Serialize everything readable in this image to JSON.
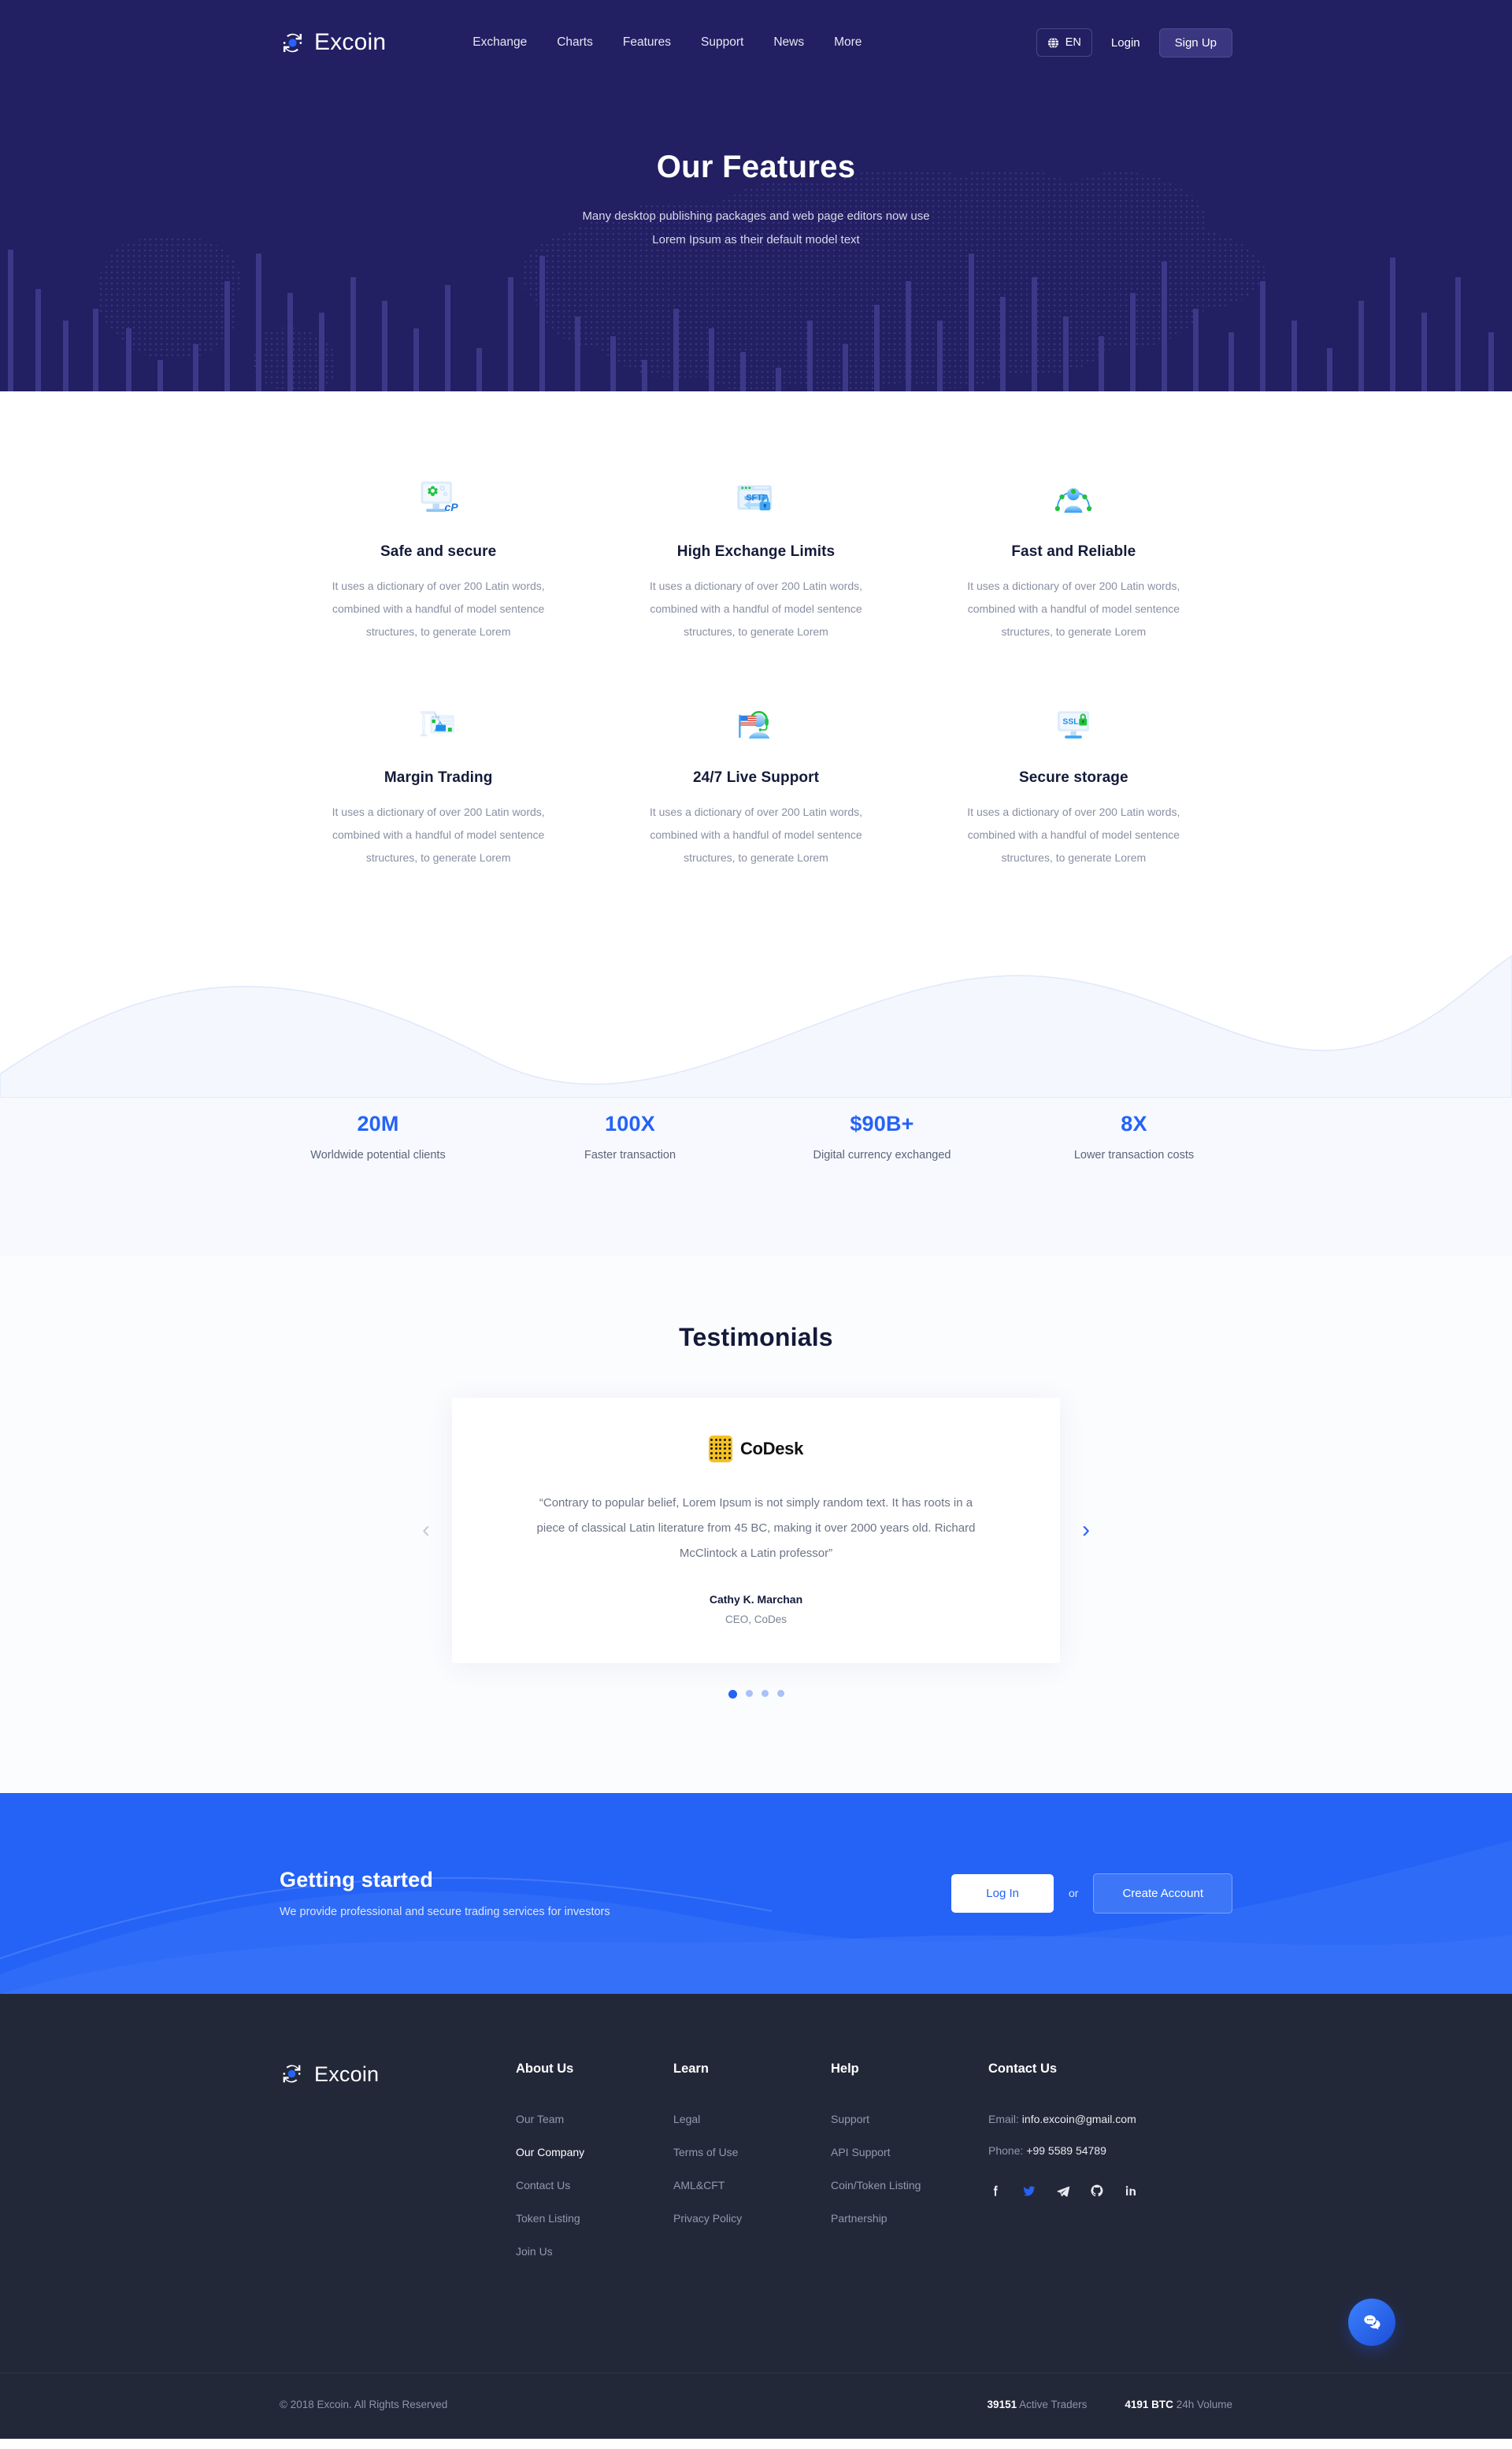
{
  "brand": {
    "name": "Excoin",
    "logo_icon": "refresh-circle-logo-icon"
  },
  "header": {
    "nav": [
      {
        "label": "Exchange"
      },
      {
        "label": "Charts"
      },
      {
        "label": "Features"
      },
      {
        "label": "Support"
      },
      {
        "label": "News"
      },
      {
        "label": "More"
      }
    ],
    "language": {
      "label": "EN",
      "icon": "globe-icon"
    },
    "login_label": "Login",
    "signup_label": "Sign Up"
  },
  "hero": {
    "title": "Our Features",
    "subtitle_line1": "Many desktop publishing packages and web page editors now use",
    "subtitle_line2": "Lorem Ipsum as their default model text",
    "background_color": "#221f62"
  },
  "features": [
    {
      "icon": "cpanel-monitor-icon",
      "title": "Safe and secure",
      "body": "It uses a dictionary of over 200 Latin words, combined with a handful of model sentence structures, to generate Lorem"
    },
    {
      "icon": "sftp-browser-lock-icon",
      "title": "High Exchange Limits",
      "body": "It uses a dictionary of over 200 Latin words, combined with a handful of model sentence structures, to generate Lorem"
    },
    {
      "icon": "network-user-nodes-icon",
      "title": "Fast and Reliable",
      "body": "It uses a dictionary of over 200 Latin words, combined with a handful of model sentence structures, to generate Lorem"
    },
    {
      "icon": "crane-website-builder-icon",
      "title": "Margin Trading",
      "body": "It uses a dictionary of over 200 Latin words, combined with a handful of model sentence structures, to generate Lorem"
    },
    {
      "icon": "support-headset-flag-icon",
      "title": "24/7 Live Support",
      "body": "It uses a dictionary of over 200 Latin words, combined with a handful of model sentence structures, to generate Lorem"
    },
    {
      "icon": "ssl-monitor-lock-icon",
      "title": "Secure storage",
      "body": "It uses a dictionary of over 200 Latin words, combined with a handful of model sentence structures, to generate Lorem"
    }
  ],
  "stats": [
    {
      "value": "20M",
      "label": "Worldwide potential clients"
    },
    {
      "value": "100X",
      "label": "Faster transaction"
    },
    {
      "value": "$90B+",
      "label": "Digital currency exchanged"
    },
    {
      "value": "8X",
      "label": "Lower transaction costs"
    }
  ],
  "testimonials": {
    "heading": "Testimonials",
    "prev_icon": "chevron-left-icon",
    "next_icon": "chevron-right-icon",
    "slide": {
      "company_logo_text": "CoDesk",
      "quote": "“Contrary to popular belief, Lorem Ipsum is not simply random text. It has roots in a piece of classical Latin literature from 45 BC, making it over 2000 years old. Richard McClintock a Latin professor”",
      "author": "Cathy K. Marchan",
      "role": "CEO, CoDes"
    },
    "dots_total": 4,
    "dots_active_index": 0
  },
  "cta": {
    "title": "Getting started",
    "subtitle": "We provide professional and secure trading services for investors",
    "login_label": "Log In",
    "or_label": "or",
    "create_label": "Create Account",
    "background_color": "#2563f6"
  },
  "footer": {
    "columns": [
      {
        "title": "About Us",
        "links": [
          {
            "label": "Our Team",
            "active": false
          },
          {
            "label": "Our Company",
            "active": true
          },
          {
            "label": "Contact Us",
            "active": false
          },
          {
            "label": "Token Listing",
            "active": false
          },
          {
            "label": "Join Us",
            "active": false
          }
        ]
      },
      {
        "title": "Learn",
        "links": [
          {
            "label": "Legal",
            "active": false
          },
          {
            "label": "Terms of Use",
            "active": false
          },
          {
            "label": "AML&CFT",
            "active": false
          },
          {
            "label": "Privacy Policy",
            "active": false
          }
        ]
      },
      {
        "title": "Help",
        "links": [
          {
            "label": "Support",
            "active": false
          },
          {
            "label": "API Support",
            "active": false
          },
          {
            "label": "Coin/Token Listing",
            "active": false
          },
          {
            "label": "Partnership",
            "active": false
          }
        ]
      }
    ],
    "contact": {
      "title": "Contact Us",
      "email_key": "Email:",
      "email_value": "info.excoin@gmail.com",
      "phone_key": "Phone:",
      "phone_value": "+99 5589 54789",
      "socials": [
        {
          "name": "facebook-icon",
          "color": "#e8eaf0"
        },
        {
          "name": "twitter-icon",
          "color": "#2563f6"
        },
        {
          "name": "telegram-icon",
          "color": "#e8eaf0"
        },
        {
          "name": "github-icon",
          "color": "#e8eaf0"
        },
        {
          "name": "linkedin-icon",
          "color": "#e8eaf0"
        }
      ]
    },
    "chat_icon": "chat-bubbles-icon",
    "copyright": "© 2018 Excoin. All Rights Reserved",
    "bottom_stats": [
      {
        "value": "39151",
        "label": "Active Traders"
      },
      {
        "value": "4191 BTC",
        "label": "24h Volume"
      }
    ]
  }
}
